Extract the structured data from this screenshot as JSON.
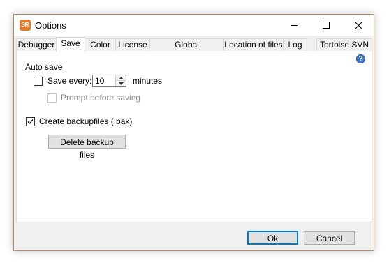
{
  "window": {
    "title": "Options",
    "app_icon_text": "SR",
    "colors": {
      "border": "#b58d6a",
      "app_icon": "#e07b2d",
      "default_button_border": "#0078d7",
      "help_icon": "#3f78c7"
    }
  },
  "tabs": [
    {
      "label": "Debugger",
      "active": false
    },
    {
      "label": "Save",
      "active": true
    },
    {
      "label": "Color",
      "active": false
    },
    {
      "label": "License",
      "active": false
    },
    {
      "label": "Global configuration",
      "active": false
    },
    {
      "label": "Location of files",
      "active": false
    },
    {
      "label": "Log",
      "active": false
    },
    {
      "label": "Tortoise SVN",
      "active": false
    }
  ],
  "save": {
    "group_label": "Auto save",
    "save_every_label": "Save every:",
    "save_every_checked": false,
    "interval_value": "10",
    "interval_unit": "minutes",
    "prompt_label": "Prompt before saving",
    "prompt_checked": false,
    "prompt_enabled": false,
    "backup_label": "Create backupfiles (.bak)",
    "backup_checked": true,
    "delete_backup_button": "Delete backup files",
    "help_icon": "?"
  },
  "footer": {
    "ok": "Ok",
    "cancel": "Cancel"
  }
}
